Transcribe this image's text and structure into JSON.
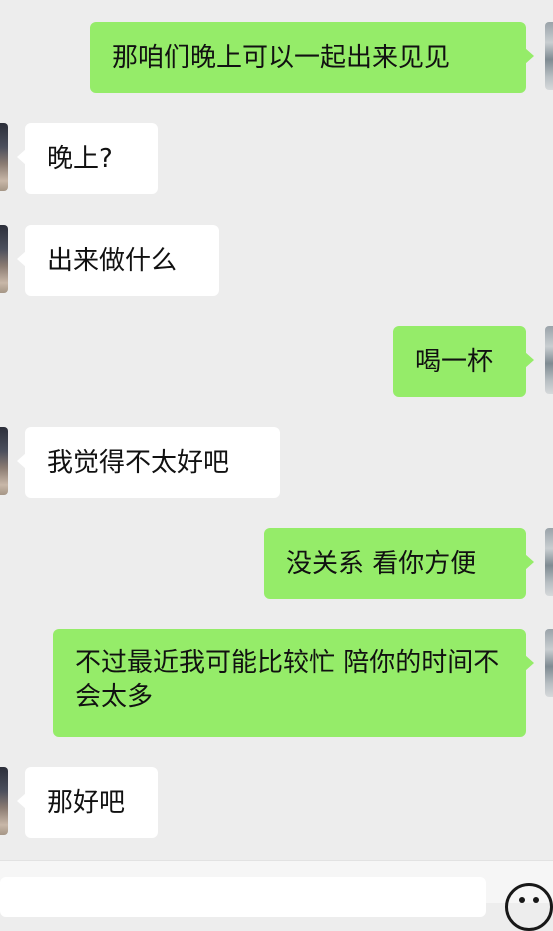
{
  "messages": [
    {
      "side": "out",
      "text": "那咱们晚上可以一起出来见见"
    },
    {
      "side": "in",
      "text": "晚上?"
    },
    {
      "side": "in",
      "text": "出来做什么"
    },
    {
      "side": "out",
      "text": "喝一杯"
    },
    {
      "side": "in",
      "text": "我觉得不太好吧"
    },
    {
      "side": "out",
      "text": "没关系 看你方便"
    },
    {
      "side": "out",
      "text": "不过最近我可能比较忙 陪你的时间不会太多"
    },
    {
      "side": "in",
      "text": "那好吧"
    }
  ],
  "icons": {
    "emoji": "emoji-face-icon"
  },
  "colors": {
    "background": "#ededed",
    "outgoing_bubble": "#95ec69",
    "incoming_bubble": "#ffffff"
  }
}
